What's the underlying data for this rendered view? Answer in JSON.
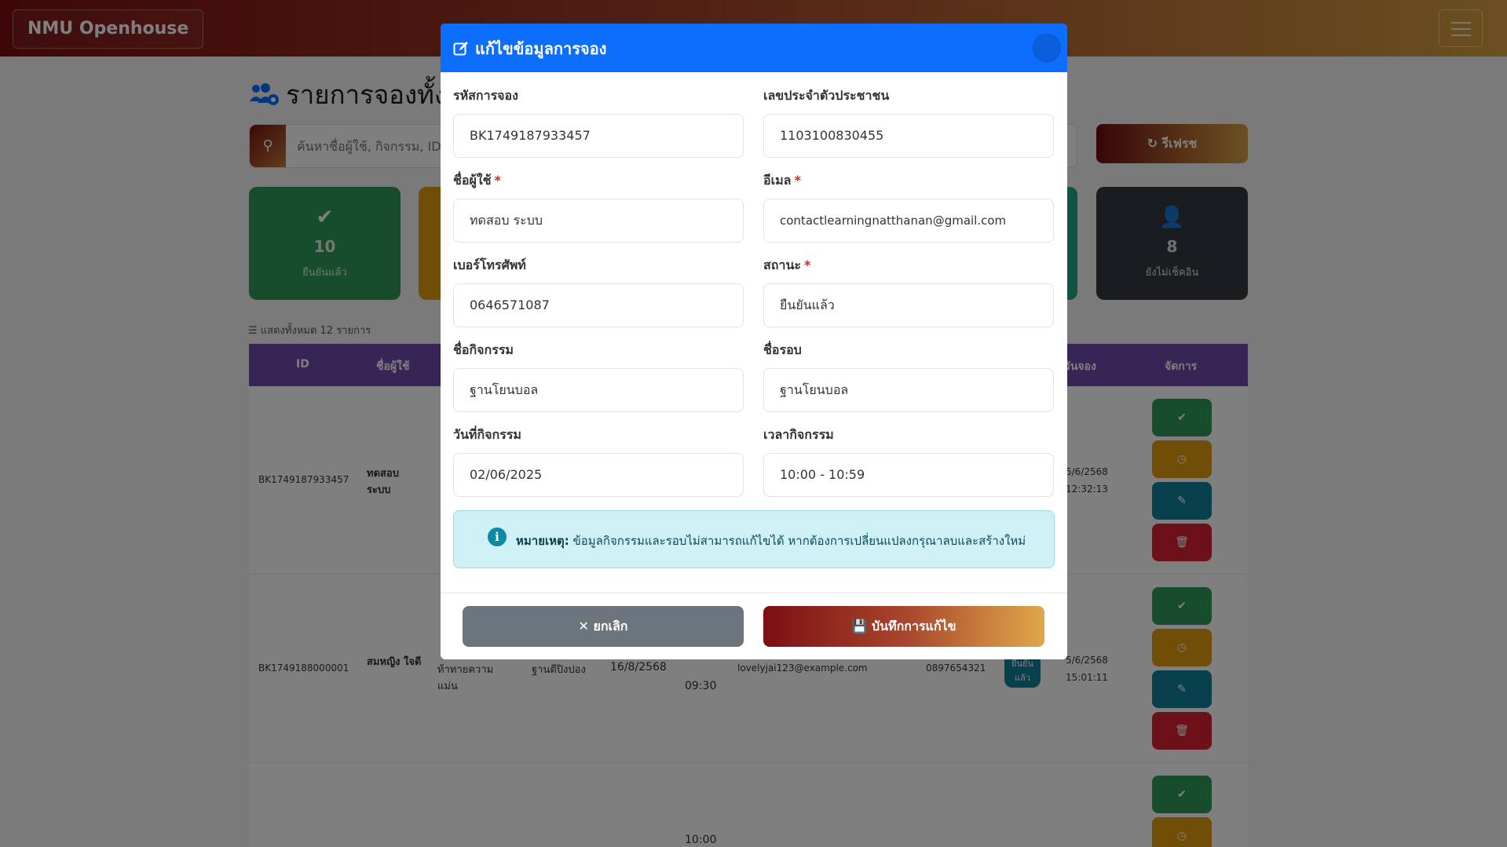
{
  "navbar": {
    "brand": "NMU Openhouse"
  },
  "page": {
    "title": "รายการจองทั้ง",
    "search_placeholder": "ค้นหาชื่อผู้ใช้, กิจกรรม, ID, อ",
    "refresh_label": "รีเฟรช"
  },
  "stats": [
    {
      "value": "10",
      "label": "ยืนยันแล้ว",
      "color": "#2f9a5a"
    },
    {
      "value": "8",
      "label": "ยังไม่เช็คอิน",
      "color": "#343a40"
    }
  ],
  "list_count": "แสดงทั้งหมด 12 รายการ",
  "table": {
    "headers": {
      "id": "ID",
      "user": "ชื่อผู้ใช้",
      "booked": "วันจอง",
      "actions": "จัดการ"
    },
    "rows": [
      {
        "id": "BK1749187933457",
        "user": "ทดสอบ ระบบ",
        "booked_date": "5/6/2568",
        "booked_time": "12:32:13"
      },
      {
        "id": "BK1749188000001",
        "user": "สมหญิง ใจดี",
        "activity": "ท้าทายความแม่น",
        "round": "ฐานตีปิงปอง",
        "date": "16/8/2568",
        "time": "09:30",
        "email": "lovelyjai123@example.com",
        "phone": "0897654321",
        "status": "ยืนยันแล้ว",
        "booked_date": "5/6/2568",
        "booked_time": "15:01:11"
      },
      {
        "time": "10:00"
      }
    ]
  },
  "modal": {
    "title": "แก้ไขข้อมูลการจอง",
    "fields": {
      "booking_code": {
        "label": "รหัสการจอง",
        "value": "BK1749187933457"
      },
      "national_id": {
        "label": "เลขประจำตัวประชาชน",
        "value": "1103100830455"
      },
      "username": {
        "label": "ชื่อผู้ใช้",
        "value": "ทดสอบ ระบบ"
      },
      "email": {
        "label": "อีเมล",
        "value": "contactlearningnatthanan@gmail.com"
      },
      "phone": {
        "label": "เบอร์โทรศัพท์",
        "value": "0646571087"
      },
      "status": {
        "label": "สถานะ",
        "value": "ยืนยันแล้ว"
      },
      "activity": {
        "label": "ชื่อกิจกรรม",
        "value": "ฐานโยนบอล"
      },
      "round": {
        "label": "ชื่อรอบ",
        "value": "ฐานโยนบอล"
      },
      "date": {
        "label": "วันที่กิจกรรม",
        "value": "02/06/2025"
      },
      "time": {
        "label": "เวลากิจกรรม",
        "value": "10:00 - 10:59"
      }
    },
    "required_mark": "*",
    "note_label": "หมายเหตุ:",
    "note_text": "ข้อมูลกิจกรรมและรอบไม่สามารถแก้ไขได้ หากต้องการเปลี่ยนแปลงกรุณาลบและสร้างใหม่",
    "cancel_label": "ยกเลิก",
    "save_label": "บันทึกการแก้ไข"
  },
  "colors": {
    "primary": "#0d6efd",
    "brand_dark": "#7a0e10",
    "brand_gold": "#d4a042"
  }
}
